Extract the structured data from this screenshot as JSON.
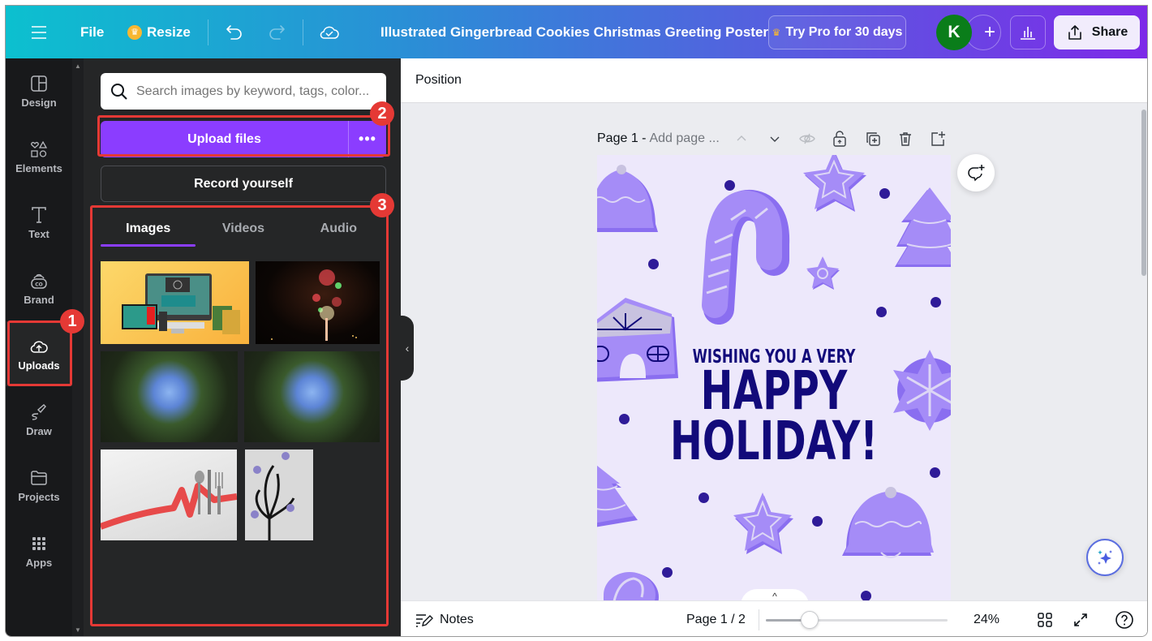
{
  "topbar": {
    "menu_icon": "hamburger-icon",
    "file_label": "File",
    "resize_label": "Resize",
    "undo_icon": "undo-icon",
    "redo_icon": "redo-icon",
    "save_status_icon": "cloud-check-icon",
    "document_title": "Illustrated Gingerbread Cookies Christmas Greeting Poster",
    "try_pro_label": "Try Pro for 30 days",
    "avatar_initial": "K",
    "avatar_color": "#0a7d1a",
    "add_member_label": "+",
    "share_label": "Share"
  },
  "rail": {
    "items": [
      {
        "label": "Design",
        "icon": "design-layout-icon"
      },
      {
        "label": "Elements",
        "icon": "elements-shapes-icon"
      },
      {
        "label": "Text",
        "icon": "text-t-icon"
      },
      {
        "label": "Brand",
        "icon": "brand-icon"
      },
      {
        "label": "Uploads",
        "icon": "cloud-upload-icon",
        "active": true
      },
      {
        "label": "Draw",
        "icon": "draw-pen-icon"
      },
      {
        "label": "Projects",
        "icon": "folder-icon"
      },
      {
        "label": "Apps",
        "icon": "apps-grid-icon"
      }
    ]
  },
  "uploads_panel": {
    "search_placeholder": "Search images by keyword, tags, color...",
    "upload_button": "Upload files",
    "more_label": "•••",
    "record_button": "Record yourself",
    "tabs": [
      {
        "label": "Images",
        "active": true
      },
      {
        "label": "Videos",
        "active": false
      },
      {
        "label": "Audio",
        "active": false
      }
    ],
    "images": [
      {
        "alt": "Online learning devices illustration on yellow background"
      },
      {
        "alt": "Fireworks in night sky"
      },
      {
        "alt": "Looking up at tall pine trees against blue sky"
      },
      {
        "alt": "Looking up at tall pine trees against blue sky (copy)"
      },
      {
        "alt": "Cutlery tied with red ribbon on white table"
      },
      {
        "alt": "Black flower wall decal with purple blossoms"
      }
    ]
  },
  "annotations": [
    {
      "number": "1",
      "target": "Uploads rail item"
    },
    {
      "number": "2",
      "target": "Upload files button"
    },
    {
      "number": "3",
      "target": "Uploaded media grid"
    }
  ],
  "context_bar": {
    "position_label": "Position"
  },
  "page_header": {
    "page_label": "Page 1 -",
    "title_placeholder": "Add page ...",
    "icons": [
      "chevron-up-icon",
      "chevron-down-icon",
      "hide-eye-icon",
      "lock-icon",
      "duplicate-page-icon",
      "trash-icon",
      "add-page-icon"
    ]
  },
  "poster": {
    "line1": "WISHING YOU A VERY",
    "line2": "HAPPY",
    "line3": "HOLIDAY!",
    "background": "#ede8fb",
    "text_color": "#120a7a",
    "cookie_color": "#a58cf7",
    "dot_color": "#2f1b98"
  },
  "bottombar": {
    "notes_label": "Notes",
    "page_indicator": "Page 1 / 2",
    "zoom_percent": 24,
    "zoom_label": "24%",
    "zoom_slider_fraction": 0.24
  }
}
